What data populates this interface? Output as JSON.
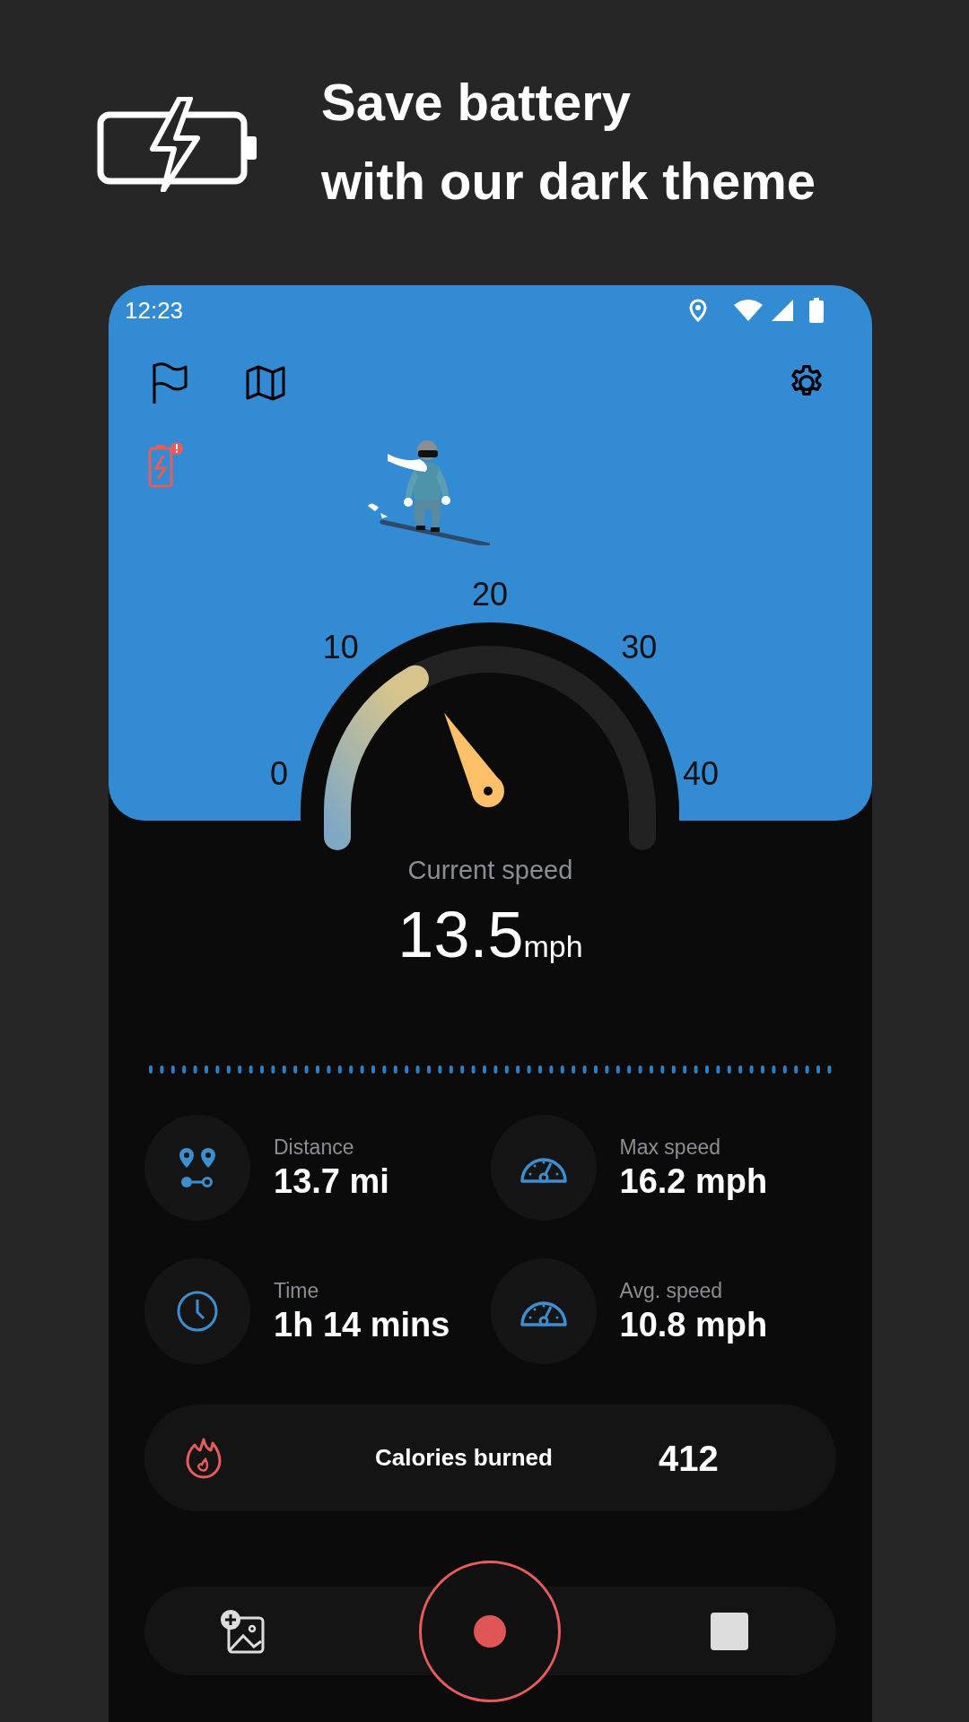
{
  "promo": {
    "headline": [
      "Save battery",
      "with our dark theme"
    ]
  },
  "status_bar": {
    "time": "12:23"
  },
  "speedometer": {
    "ticks": [
      "0",
      "10",
      "20",
      "30",
      "40"
    ],
    "label": "Current speed",
    "value": "13.5",
    "unit": "mph"
  },
  "stats": [
    {
      "kind": "route",
      "label": "Distance",
      "value": "13.7 mi"
    },
    {
      "kind": "gauge",
      "label": "Max speed",
      "value": "16.2 mph"
    },
    {
      "kind": "clock",
      "label": "Time",
      "value": "1h 14 mins"
    },
    {
      "kind": "gauge",
      "label": "Avg. speed",
      "value": "10.8 mph"
    }
  ],
  "calories": {
    "label": "Calories burned",
    "value": "412"
  }
}
